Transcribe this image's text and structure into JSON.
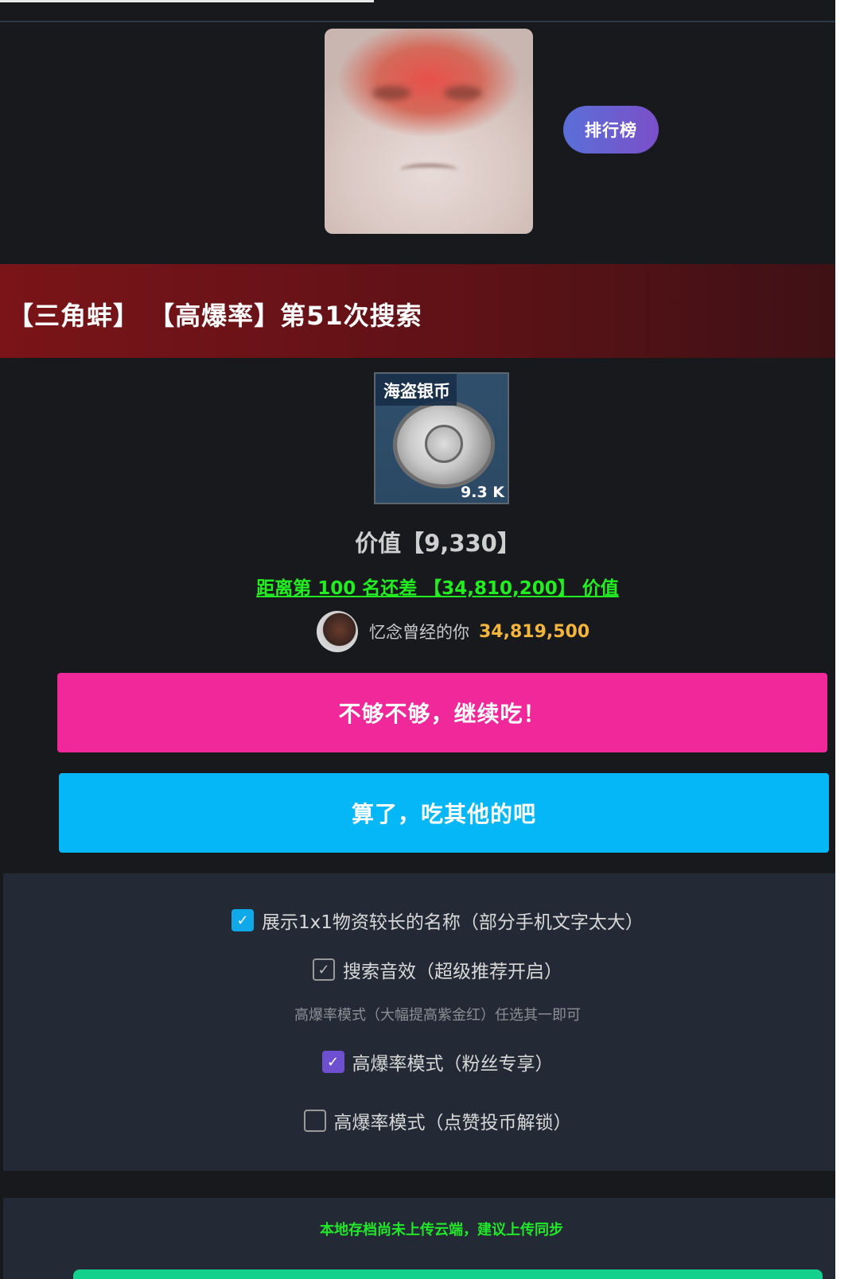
{
  "header": {
    "rank_button": "排行榜"
  },
  "banner": {
    "title": "【三角蚌】 【高爆率】第51次搜索"
  },
  "item": {
    "name": "海盗银币",
    "quantity": "9.3 K",
    "image_icon": "silver-coin-icon"
  },
  "value": {
    "label": "价值【9,330】",
    "gap_label": "距离第 100 名还差 【34,810,200】 价值"
  },
  "leader": {
    "name": "忆念曾经的你",
    "value": "34,819,500"
  },
  "actions": {
    "continue_label": "不够不够，继续吃！",
    "stop_label": "算了，吃其他的吧"
  },
  "options": {
    "show_long_names": "展示1x1物资较长的名称（部分手机文字太大）",
    "search_sound": "搜索音效（超级推荐开启）",
    "hint": "高爆率模式（大幅提高紫金红）任选其一即可",
    "high_rate_fans": "高爆率模式（粉丝专享）",
    "high_rate_like": "高爆率模式（点赞投币解锁）",
    "show_long_names_checked": true,
    "search_sound_checked": true,
    "high_rate_fans_checked": true,
    "high_rate_like_checked": false
  },
  "cloud": {
    "notice": "本地存档尚未上传云端，建议上传同步"
  },
  "colors": {
    "pink": "#f0289a",
    "blue": "#06b7f8",
    "green": "#22ee22",
    "gold": "#f3b53b",
    "purple": "#6d4fcf"
  }
}
